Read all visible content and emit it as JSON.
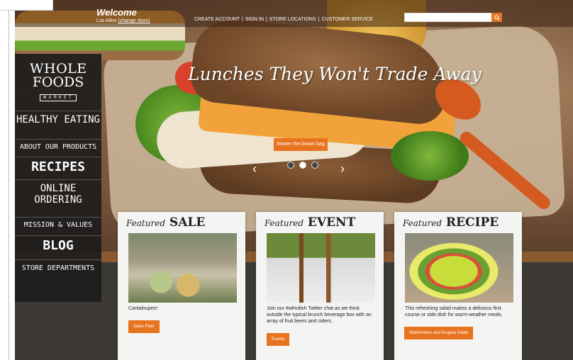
{
  "header": {
    "welcome": "Welcome",
    "location_city": "Los Altos",
    "location_change": "(change store)",
    "links": [
      "CREATE ACCOUNT",
      "SIGN IN",
      "STORE LOCATIONS",
      "CUSTOMER SERVICE"
    ],
    "search_placeholder": ""
  },
  "logo": {
    "line1": "WHOLE",
    "line2": "FOODS",
    "line3": "MARKET"
  },
  "nav": {
    "items": [
      {
        "label": "HEALTHY EATING"
      },
      {
        "label": "ABOUT OUR PRODUCTS"
      },
      {
        "label": "RECIPES"
      },
      {
        "label": "ONLINE ORDERING"
      },
      {
        "label": "MISSION & VALUES"
      },
      {
        "label": "BLOG"
      },
      {
        "label": "STORE DEPARTMENTS"
      }
    ]
  },
  "hero": {
    "title": "Lunches They Won't Trade Away",
    "button": "Master the brown bag",
    "prev": "‹",
    "next": "›",
    "active_slide": 2,
    "slide_count": 3
  },
  "cards": [
    {
      "script": "Featured",
      "title": "SALE",
      "text": "Cantaloupes!",
      "button": "Sales Flyer"
    },
    {
      "script": "Featured",
      "title": "EVENT",
      "text": "Join our #wfmdish Twitter chat as we think outside the typical brunch beverage box with an array of fruit beers and ciders.",
      "button": "Events"
    },
    {
      "script": "Featured",
      "title": "RECIPE",
      "text": "This refreshing salad makes a delicious first course or side dish for warm-weather meals.",
      "button": "Watermelon and Arugula Salad"
    }
  ],
  "colors": {
    "accent": "#e8731f",
    "nav_bg": "#1c1c1c",
    "board": "#3d3a36"
  }
}
